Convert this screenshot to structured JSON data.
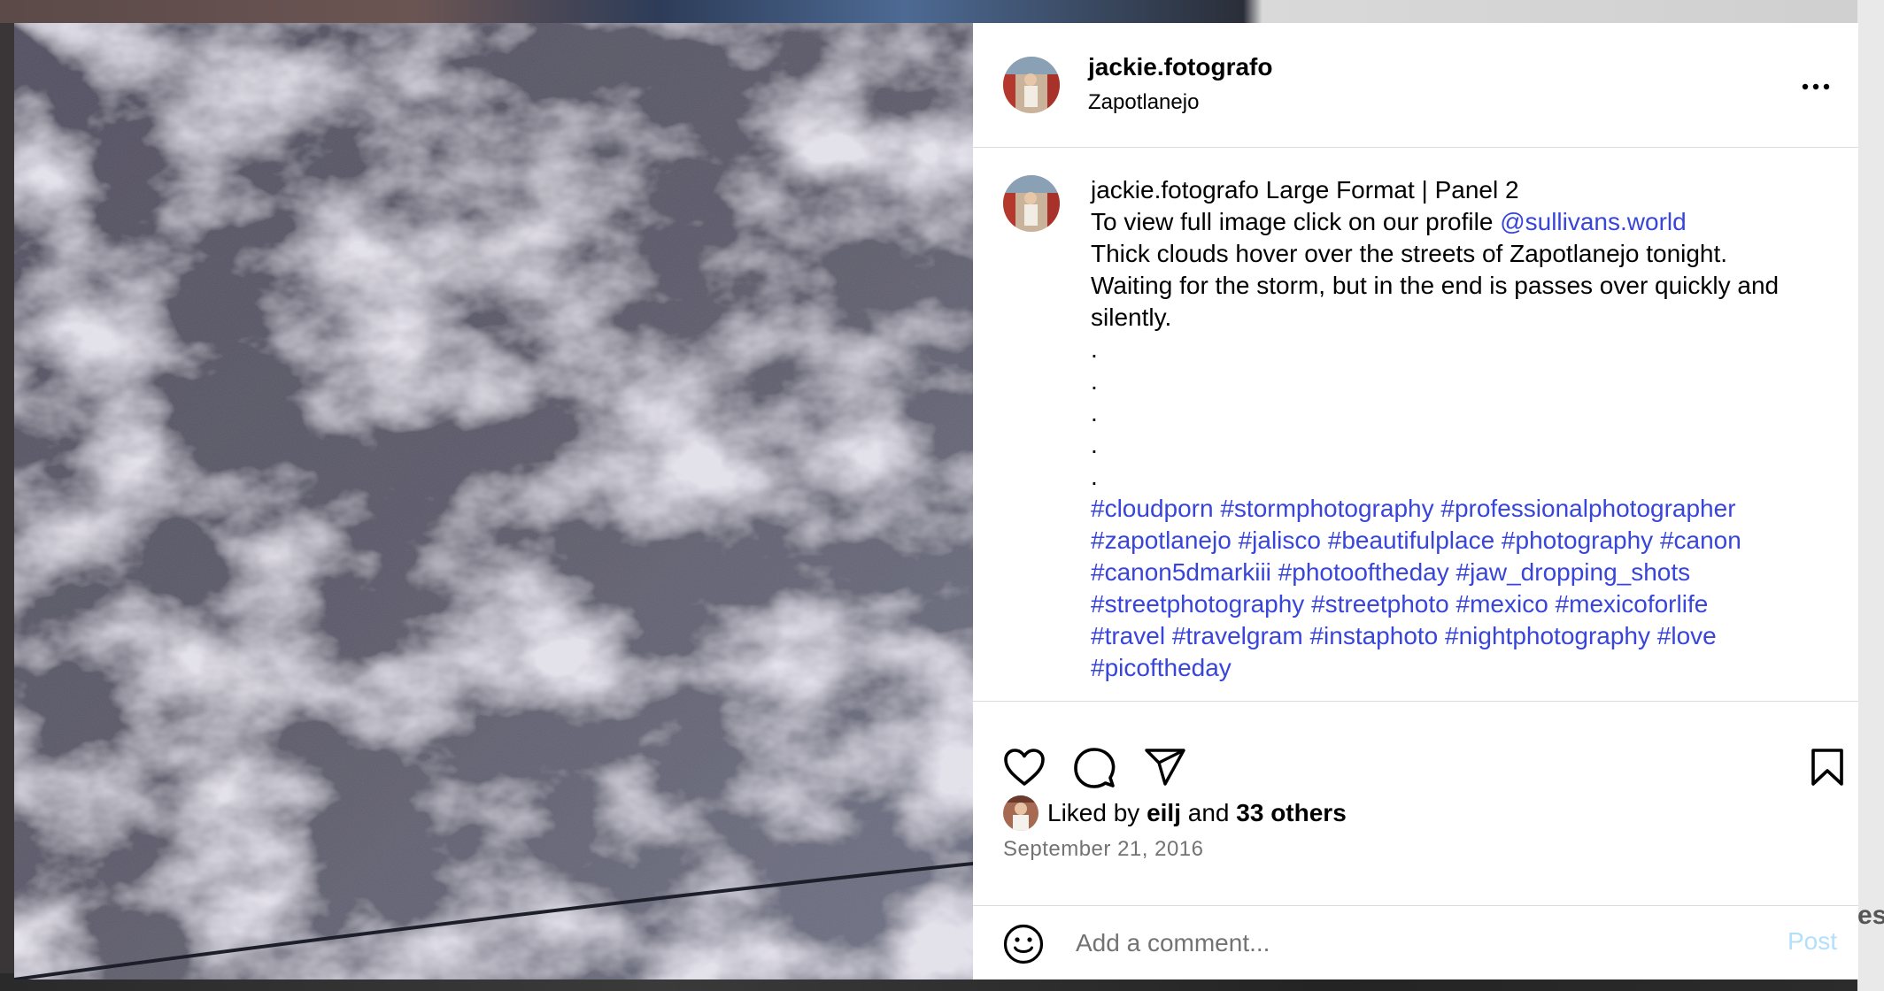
{
  "post": {
    "username": "jackie.fotografo",
    "location": "Zapotlanejo",
    "caption_title": "Large Format | Panel 2",
    "caption_line2_prefix": "To view full image click on our profile",
    "caption_mention": "@sullivans.world",
    "caption_body_1": "Thick clouds hover over the streets of Zapotlanejo tonight.",
    "caption_body_2": "Waiting for the storm, but in the end is passes over quickly and silently.",
    "dots": [
      ".",
      ".",
      ".",
      ".",
      "."
    ],
    "hashtags": [
      "#cloudporn",
      "#stormphotography",
      "#professionalphotographer",
      "#zapotlanejo",
      "#jalisco",
      "#beautifulplace",
      "#photography",
      "#canon",
      "#canon5dmarkiii",
      "#photooftheday",
      "#jaw_dropping_shots",
      "#streetphotography",
      "#streetphoto",
      "#mexico",
      "#mexicoforlife",
      "#travel",
      "#travelgram",
      "#instaphoto",
      "#nightphotography",
      "#love",
      "#picoftheday"
    ],
    "likes_prefix": "Liked by",
    "liked_by_user": "eilj",
    "likes_and": "and",
    "likes_others": "33 others",
    "date": "September 21, 2016"
  },
  "comment": {
    "placeholder": "Add a comment...",
    "post_label": "Post"
  },
  "background": {
    "partial_text": "es"
  },
  "icons": {
    "more": "more-options-icon",
    "like": "heart-icon",
    "comment": "comment-icon",
    "share": "share-icon",
    "save": "bookmark-icon",
    "emoji": "emoji-icon"
  },
  "colors": {
    "link": "#3845d8",
    "post_disabled": "#b2dffc",
    "secondary_text": "#737373",
    "divider": "#dbdbdb"
  }
}
